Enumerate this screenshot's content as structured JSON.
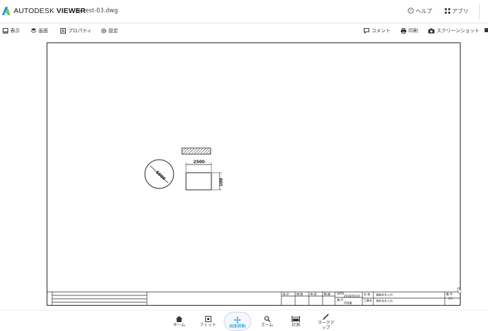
{
  "header": {
    "brand_light": "AUTODESK",
    "brand_bold": "VIEWER",
    "crumb_separator": ">",
    "filename": "test-03.dwg",
    "help_label": "ヘルプ",
    "apps_label": "アプリ"
  },
  "toolbar": {
    "view_label": "表示",
    "sheets_label": "画面",
    "properties_label": "プロパティ",
    "settings_label": "設定",
    "comments_label": "コメント",
    "print_label": "印刷",
    "screenshot_label": "スクリーンショット"
  },
  "drawing": {
    "circle_dim": "5000",
    "rect_width_dim": "2500",
    "rect_height_dim": "100",
    "title_block": {
      "date_label": "DATE",
      "date_value": "2018/05/10",
      "name_label": "名 称",
      "name_value": "図面名を入力",
      "project_label": "工事名",
      "project_value": "案件名を入力",
      "scale_label": "縮 尺",
      "sheet_label": "番 号",
      "sheet_value": "1/1",
      "col1": "設 計",
      "col2": "検 図",
      "col3": "承 認",
      "col4": "製 図",
      "drawer": "作成者"
    }
  },
  "bottom": {
    "home_label": "ホーム",
    "fit_label": "フィット",
    "pan_label": "画面移動",
    "zoom_label": "ズーム",
    "measure_label": "計測",
    "markup_label_1": "マークア",
    "markup_label_2": "ップ"
  },
  "colors": {
    "accent": "#0696d7",
    "logo_primary": "#0696d7",
    "logo_secondary": "#5fba46"
  }
}
